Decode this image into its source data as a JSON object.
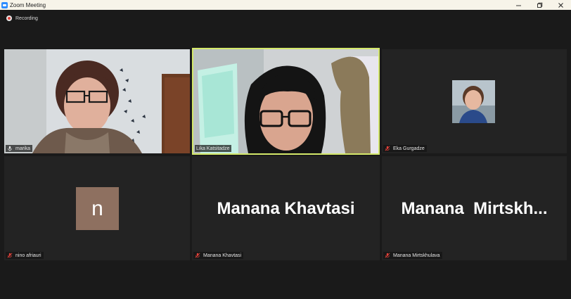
{
  "window": {
    "title": "Zoom Meeting",
    "minimize_glyph": "—",
    "restore_glyph": "❐",
    "close_glyph": "✕"
  },
  "recording": {
    "label": "Recording"
  },
  "participants": [
    {
      "name": "marika",
      "mic": "unmuted",
      "view": "video"
    },
    {
      "name": "Lika Katsitadze",
      "mic": "unmuted",
      "view": "video",
      "active_speaker": true
    },
    {
      "name": "Eka Gurgadze",
      "mic": "muted",
      "view": "profile-photo"
    },
    {
      "name": "nino afriauri",
      "mic": "muted",
      "view": "initial-avatar",
      "initial": "n"
    },
    {
      "name": "Manana Khavtasi",
      "mic": "muted",
      "view": "name-only",
      "display_name": "Manana Khavtasi"
    },
    {
      "name": "Manana Mirtskhulava",
      "mic": "muted",
      "view": "name-only",
      "display_name": "Manana  Mirtskh..."
    }
  ],
  "colors": {
    "background": "#1a1a1a",
    "tile": "#232323",
    "active_speaker_border": "#d4e86a",
    "muted_icon": "#e0413a",
    "zoom_blue": "#2d8cff"
  }
}
